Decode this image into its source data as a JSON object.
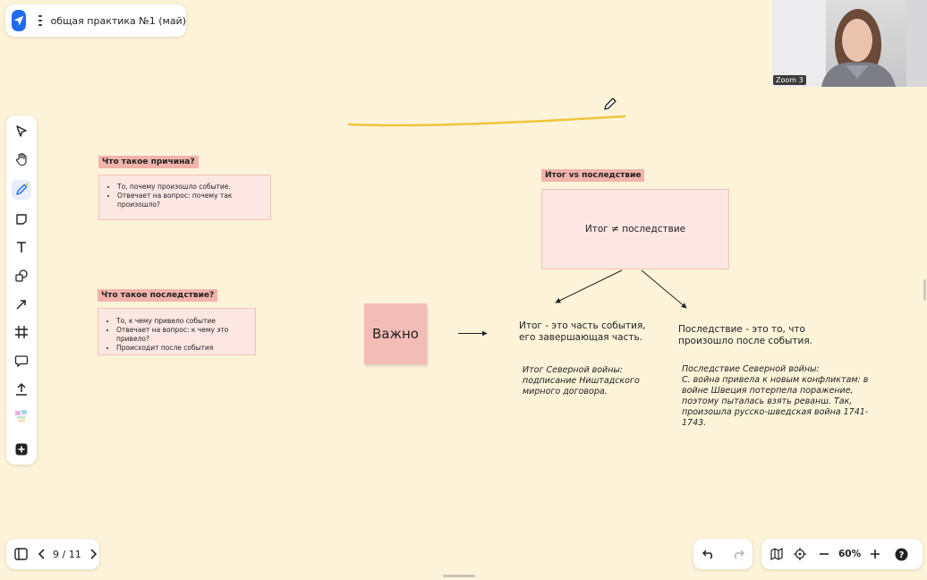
{
  "header": {
    "title": "общая практика №1 (май)"
  },
  "video": {
    "label": "Zoom 3"
  },
  "canvas": {
    "cause_title": "Что такое причина?",
    "cause_items": [
      "То, почему произошло событие.",
      "Отвечает на вопрос: почему так произошло?"
    ],
    "consequence_title": "Что такое последствие?",
    "consequence_items": [
      "То, к чему привело событие",
      "Отвечает на вопрос: к чему это привело?",
      "Происходит после события"
    ],
    "sticky_text": "Важно",
    "result_title": "Итог vs последствие",
    "result_box_text": "Итог ≠ последствие",
    "result_def": [
      "Итог - это часть события,",
      "его завершающая часть."
    ],
    "consequence_def": [
      "Последствие - это то, что",
      "произошло после события."
    ],
    "result_example": [
      "Итог Северной войны:",
      "подписание Ништадского",
      "мирного договора."
    ],
    "consequence_example": [
      "Последствие Северной войны:",
      "С. война привела к новым конфликтам: в",
      "войне Швеция потерпела поражение,",
      "поэтому пыталась взять реванш. Так,",
      "произошла русско-шведская война 1741-",
      "1743."
    ]
  },
  "pager": {
    "current": "9",
    "separator": "/",
    "total": "11"
  },
  "zoom": {
    "level": "60%"
  },
  "colors": {
    "accent": "#1e6cf0",
    "note": "#fde7e3",
    "title_tag": "#f2b3ab",
    "highlight_stroke": "#f0c43a"
  }
}
